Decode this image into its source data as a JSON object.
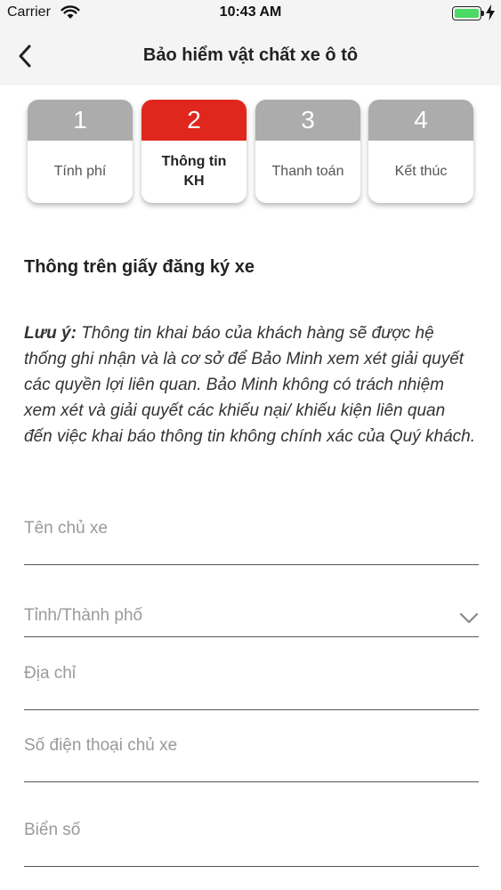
{
  "status_bar": {
    "carrier": "Carrier",
    "time": "10:43 AM",
    "battery_level": 1.0
  },
  "nav": {
    "back_icon": "chevron-left-icon",
    "title": "Bảo hiểm vật chất xe ô tô"
  },
  "stepper": {
    "active_step": 2,
    "steps": [
      {
        "number": "1",
        "label": "Tính phí"
      },
      {
        "number": "2",
        "label": "Thông tin KH"
      },
      {
        "number": "3",
        "label": "Thanh toán"
      },
      {
        "number": "4",
        "label": "Kết thúc"
      }
    ]
  },
  "form": {
    "section_title": "Thông trên giấy đăng ký xe",
    "note_label": "Lưu ý:",
    "note_text": " Thông tin khai báo của khách hàng sẽ được hệ thống ghi nhận và là cơ sở để Bảo Minh xem xét giải quyết các quyền lợi liên quan. Bảo Minh không có trách nhiệm xem xét và giải quyết các khiếu nại/ khiếu kiện liên quan đến việc khai báo thông tin không chính xác của Quý khách.",
    "fields": [
      {
        "placeholder": "Tên chủ xe",
        "value": ""
      },
      {
        "placeholder": "Tỉnh/Thành phố",
        "value": "",
        "icon": "chevron-down-icon"
      },
      {
        "placeholder": "Địa chỉ",
        "value": ""
      },
      {
        "placeholder": "Số điện thoại chủ xe",
        "value": ""
      },
      {
        "placeholder": "Biển số",
        "value": ""
      }
    ]
  },
  "colors": {
    "accent": "#e0271e",
    "step_inactive": "#acacac",
    "bar_background": "#f4f4f4"
  }
}
